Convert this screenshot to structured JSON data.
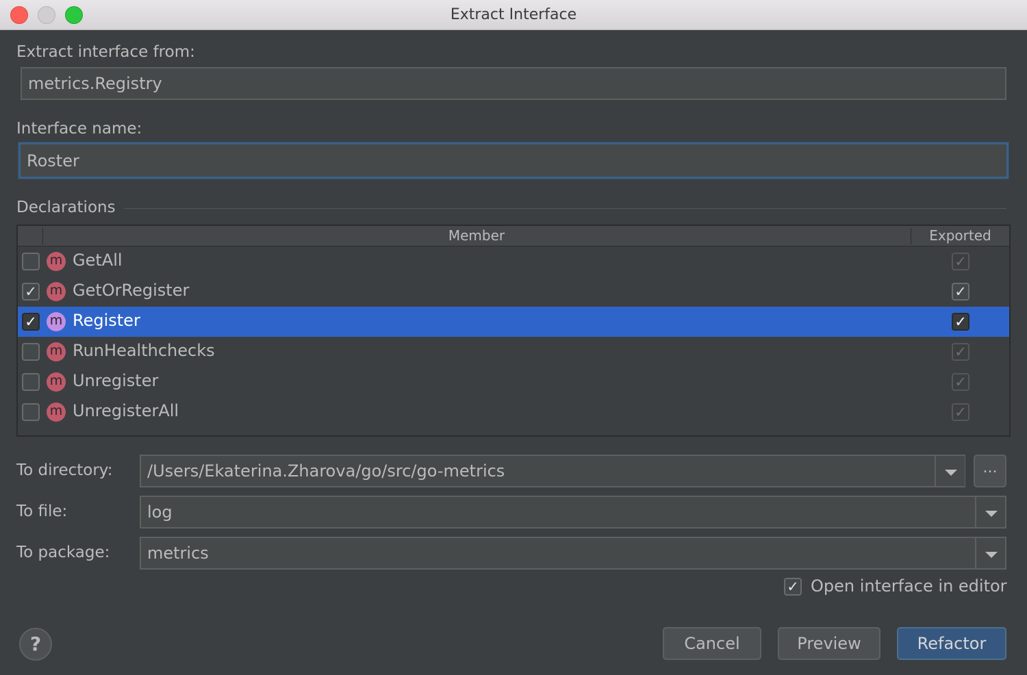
{
  "window": {
    "title": "Extract Interface"
  },
  "source": {
    "label": "Extract interface from:",
    "value": "metrics.Registry"
  },
  "interface_name": {
    "label": "Interface name:",
    "value": "Roster"
  },
  "declarations": {
    "title": "Declarations",
    "columns": {
      "member": "Member",
      "exported": "Exported"
    },
    "rows": [
      {
        "name": "GetAll",
        "checked": false,
        "exported": true,
        "exported_enabled": false,
        "selected": false,
        "icon": "m"
      },
      {
        "name": "GetOrRegister",
        "checked": true,
        "exported": true,
        "exported_enabled": true,
        "selected": false,
        "icon": "m"
      },
      {
        "name": "Register",
        "checked": true,
        "exported": true,
        "exported_enabled": true,
        "selected": true,
        "icon": "m"
      },
      {
        "name": "RunHealthchecks",
        "checked": false,
        "exported": true,
        "exported_enabled": false,
        "selected": false,
        "icon": "m"
      },
      {
        "name": "Unregister",
        "checked": false,
        "exported": true,
        "exported_enabled": false,
        "selected": false,
        "icon": "m"
      },
      {
        "name": "UnregisterAll",
        "checked": false,
        "exported": true,
        "exported_enabled": false,
        "selected": false,
        "icon": "m"
      }
    ]
  },
  "to_directory": {
    "label": "To directory:",
    "value": "/Users/Ekaterina.Zharova/go/src/go-metrics",
    "browse_label": "..."
  },
  "to_file": {
    "label": "To file:",
    "value": "log"
  },
  "to_package": {
    "label": "To package:",
    "value": "metrics"
  },
  "open_in_editor": {
    "label": "Open interface in editor",
    "checked": true
  },
  "buttons": {
    "help": "?",
    "cancel": "Cancel",
    "preview": "Preview",
    "refactor": "Refactor"
  },
  "colors": {
    "background": "#3c3f41",
    "selection": "#2f65ca",
    "method_icon": "#c05a6b",
    "default_button": "#365880"
  }
}
